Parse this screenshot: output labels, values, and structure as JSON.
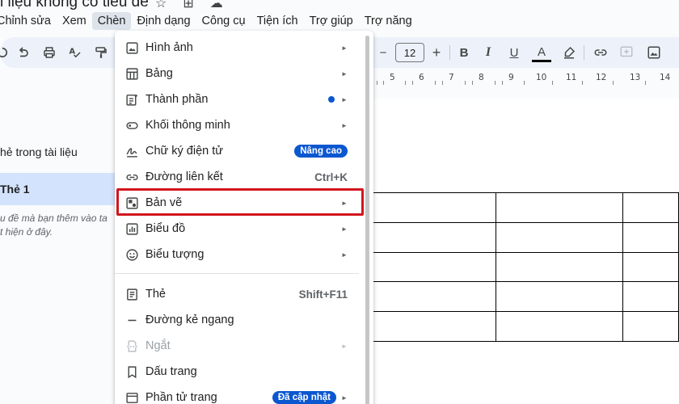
{
  "document": {
    "title": "i liệu không có tiêu đề"
  },
  "menubar": {
    "items": [
      "Chỉnh sửa",
      "Xem",
      "Chèn",
      "Định dạng",
      "Công cụ",
      "Tiện ích",
      "Trợ giúp",
      "Trợ năng"
    ],
    "active_index": 2
  },
  "toolbar": {
    "font_size": "12",
    "decrease_label": "−",
    "increase_label": "+",
    "bold": "B",
    "italic": "I",
    "underline": "U",
    "text_color": "A"
  },
  "ruler": {
    "numbers": [
      "5",
      "6",
      "7",
      "8",
      "9",
      "10",
      "11",
      "12",
      "13",
      "14"
    ]
  },
  "left_panel": {
    "heading": "hẻ trong tài liệu",
    "active_tab": "Thẻ 1",
    "hint_line1": "u đề mà bạn thêm vào ta",
    "hint_line2": "t hiện ở đây."
  },
  "insert_menu": {
    "items": [
      {
        "label": "Hình ảnh",
        "icon": "image-icon"
      },
      {
        "label": "Bảng",
        "icon": "table-icon"
      },
      {
        "label": "Thành phần",
        "icon": "building-blocks-icon"
      },
      {
        "label": "Khối thông minh",
        "icon": "smart-chip-icon"
      },
      {
        "label": "Chữ ký điện tử",
        "icon": "signature-icon",
        "badge": "Nâng cao"
      },
      {
        "label": "Đường liên kết",
        "icon": "link-icon",
        "shortcut": "Ctrl+K"
      },
      {
        "label": "Bản vẽ",
        "icon": "drawing-icon"
      },
      {
        "label": "Biểu đồ",
        "icon": "chart-icon"
      },
      {
        "label": "Biểu tượng",
        "icon": "emoji-icon"
      },
      {
        "label": "Thẻ",
        "icon": "tab-icon",
        "shortcut": "Shift+F11"
      },
      {
        "label": "Đường kẻ ngang",
        "icon": "horizontal-line-icon"
      },
      {
        "label": "Ngắt",
        "icon": "break-icon"
      },
      {
        "label": "Dấu trang",
        "icon": "bookmark-icon"
      },
      {
        "label": "Phần tử trang",
        "icon": "page-elements-icon",
        "badge": "Đã cập nhật"
      }
    ],
    "highlighted": "Bản vẽ",
    "arrow_glyph": "►"
  },
  "colors": {
    "accent": "#0b57d0",
    "highlight": "#d2161e",
    "toolbar_bg": "#edf2fa",
    "selected_tab": "#d3e3fd"
  }
}
